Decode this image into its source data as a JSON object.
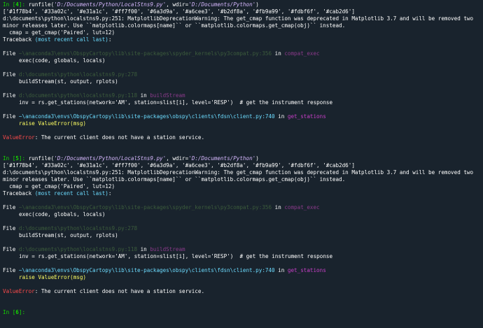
{
  "blocks": [
    {
      "prompt_in": "In [",
      "prompt_num": "4",
      "prompt_close": "]: ",
      "cmd_pre": "runfile(",
      "cmd_file": "'D:/Documents/Python/LocalStns9.py'",
      "cmd_mid": ", wdir=",
      "cmd_wdir": "'D:/Documents/Python'",
      "cmd_post": ")",
      "colors_line": "['#1f78b4', '#33a02c', '#e31a1c', '#ff7f00', '#6a3d9a', '#a6cee3', '#b2df8a', '#fb9a99', '#fdbf6f', '#cab2d6']",
      "warn1": "d:\\documents\\python\\localstns9.py:251: MatplotlibDeprecationWarning: The get_cmap function was deprecated in Matplotlib 3.7 and will be removed two",
      "warn2": "minor releases later. Use ``matplotlib.colormaps[name]`` or ``matplotlib.colormaps.get_cmap(obj)`` instead.",
      "warn3": "  cmap = get_cmap('Paired', lut=12)",
      "tb_head": "Traceback ",
      "tb_paren": "(most recent call last)",
      "tb_colon": ":",
      "frames": [
        {
          "file_kw": "File ",
          "path": "~\\anaconda3\\envs\\ObspyCartopy\\lib\\site-packages\\spyder_kernels\\py3compat.py:356",
          "path_style": "dim",
          "in_kw": " in ",
          "func": "compat_exec",
          "func_style": "dim",
          "code": "exec(code, globals, locals)",
          "code_style": "white"
        },
        {
          "file_kw": "File ",
          "path": "d:\\documents\\python\\localstns9.py:278",
          "path_style": "dim",
          "in_kw": "",
          "func": "",
          "func_style": "dim",
          "code": "buildStream(st, output, rplots)",
          "code_style": "white"
        },
        {
          "file_kw": "File ",
          "path": "d:\\documents\\python\\localstns9.py:118",
          "path_style": "dim",
          "in_kw": " in ",
          "func": "buildStream",
          "func_style": "dim",
          "code": "inv = rs.get_stations(network='AM', station=slist[i], level='RESP')  # get the instrument response",
          "code_style": "white"
        },
        {
          "file_kw": "File ",
          "path": "~\\anaconda3\\envs\\ObspyCartopy\\lib\\site-packages\\obspy\\clients\\fdsn\\client.py:740",
          "path_style": "cyan",
          "in_kw": " in ",
          "func": "get_stations",
          "func_style": "bright",
          "code": "raise ValueError(msg)",
          "code_style": "yellow"
        }
      ],
      "error_name": "ValueError",
      "error_msg": ": The current client does not have a station service."
    },
    {
      "prompt_in": "In [",
      "prompt_num": "5",
      "prompt_close": "]: ",
      "cmd_pre": "runfile(",
      "cmd_file": "'D:/Documents/Python/LocalStns9.py'",
      "cmd_mid": ", wdir=",
      "cmd_wdir": "'D:/Documents/Python'",
      "cmd_post": ")",
      "colors_line": "['#1f78b4', '#33a02c', '#e31a1c', '#ff7f00', '#6a3d9a', '#a6cee3', '#b2df8a', '#fb9a99', '#fdbf6f', '#cab2d6']",
      "warn1": "d:\\documents\\python\\localstns9.py:251: MatplotlibDeprecationWarning: The get_cmap function was deprecated in Matplotlib 3.7 and will be removed two",
      "warn2": "minor releases later. Use ``matplotlib.colormaps[name]`` or ``matplotlib.colormaps.get_cmap(obj)`` instead.",
      "warn3": "  cmap = get_cmap('Paired', lut=12)",
      "tb_head": "Traceback ",
      "tb_paren": "(most recent call last)",
      "tb_colon": ":",
      "frames": [
        {
          "file_kw": "File ",
          "path": "~\\anaconda3\\envs\\ObspyCartopy\\lib\\site-packages\\spyder_kernels\\py3compat.py:356",
          "path_style": "dim",
          "in_kw": " in ",
          "func": "compat_exec",
          "func_style": "dim",
          "code": "exec(code, globals, locals)",
          "code_style": "white"
        },
        {
          "file_kw": "File ",
          "path": "d:\\documents\\python\\localstns9.py:278",
          "path_style": "dim",
          "in_kw": "",
          "func": "",
          "func_style": "dim",
          "code": "buildStream(st, output, rplots)",
          "code_style": "white"
        },
        {
          "file_kw": "File ",
          "path": "d:\\documents\\python\\localstns9.py:118",
          "path_style": "dim",
          "in_kw": " in ",
          "func": "buildStream",
          "func_style": "dim",
          "code": "inv = rs.get_stations(network='AM', station=slist[i], level='RESP')  # get the instrument response",
          "code_style": "white"
        },
        {
          "file_kw": "File ",
          "path": "~\\anaconda3\\envs\\ObspyCartopy\\lib\\site-packages\\obspy\\clients\\fdsn\\client.py:740",
          "path_style": "cyan",
          "in_kw": " in ",
          "func": "get_stations",
          "func_style": "bright",
          "code": "raise ValueError(msg)",
          "code_style": "yellow"
        }
      ],
      "error_name": "ValueError",
      "error_msg": ": The current client does not have a station service."
    }
  ],
  "final_prompt": {
    "prompt_in": "In [",
    "prompt_num": "6",
    "prompt_close": "]:"
  },
  "colors": {
    "background": "#19232d",
    "prompt": "#15d800",
    "string": "#d7b8ff",
    "path_dim": "#3c5c3c",
    "path_cyan": "#6cdcff",
    "func": "#c83fc8",
    "error": "#ff4b4b",
    "raise": "#ffff62"
  }
}
